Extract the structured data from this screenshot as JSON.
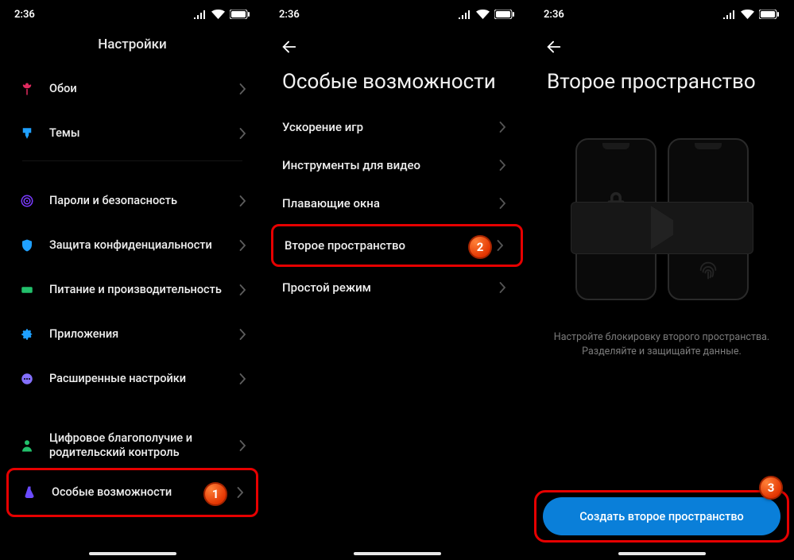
{
  "status": {
    "time": "2:36"
  },
  "screen1": {
    "title": "Настройки",
    "items": [
      {
        "name": "wallpaper",
        "icon": "tulip",
        "color": "#e02a5f",
        "label": "Обои"
      },
      {
        "name": "themes",
        "icon": "brush",
        "color": "#1fa0ff",
        "label": "Темы"
      }
    ],
    "items2": [
      {
        "name": "security",
        "icon": "target",
        "color": "#7a3bff",
        "label": "Пароли и безопасность"
      },
      {
        "name": "privacy",
        "icon": "shield",
        "color": "#1fa0ff",
        "label": "Защита конфиденциальности"
      },
      {
        "name": "battery-perf",
        "icon": "bolt",
        "color": "#22c06b",
        "label": "Питание и производительность"
      },
      {
        "name": "apps",
        "icon": "gear",
        "color": "#1fa0ff",
        "label": "Приложения"
      },
      {
        "name": "more",
        "icon": "dots",
        "color": "#8470ff",
        "label": "Расширенные настройки"
      }
    ],
    "items3": [
      {
        "name": "wellbeing",
        "icon": "person",
        "color": "#22c06b",
        "label": "Цифровое благополучие и родительский контроль"
      },
      {
        "name": "special",
        "icon": "flask",
        "color": "#6b4bff",
        "label": "Особые возможности",
        "highlight": true,
        "badge": "1"
      }
    ]
  },
  "screen2": {
    "title": "Особые возможности",
    "items": [
      {
        "name": "game-boost",
        "label": "Ускорение игр"
      },
      {
        "name": "video-tools",
        "label": "Инструменты для видео"
      },
      {
        "name": "floating",
        "label": "Плавающие окна"
      },
      {
        "name": "second-space",
        "label": "Второе пространство",
        "highlight": true,
        "badge": "2"
      },
      {
        "name": "simple-mode",
        "label": "Простой режим"
      }
    ]
  },
  "screen3": {
    "title": "Второе пространство",
    "desc": "Настройте блокировку второго пространства. Разделяйте и защищайте данные.",
    "button": "Создать второе пространство",
    "badge": "3"
  }
}
